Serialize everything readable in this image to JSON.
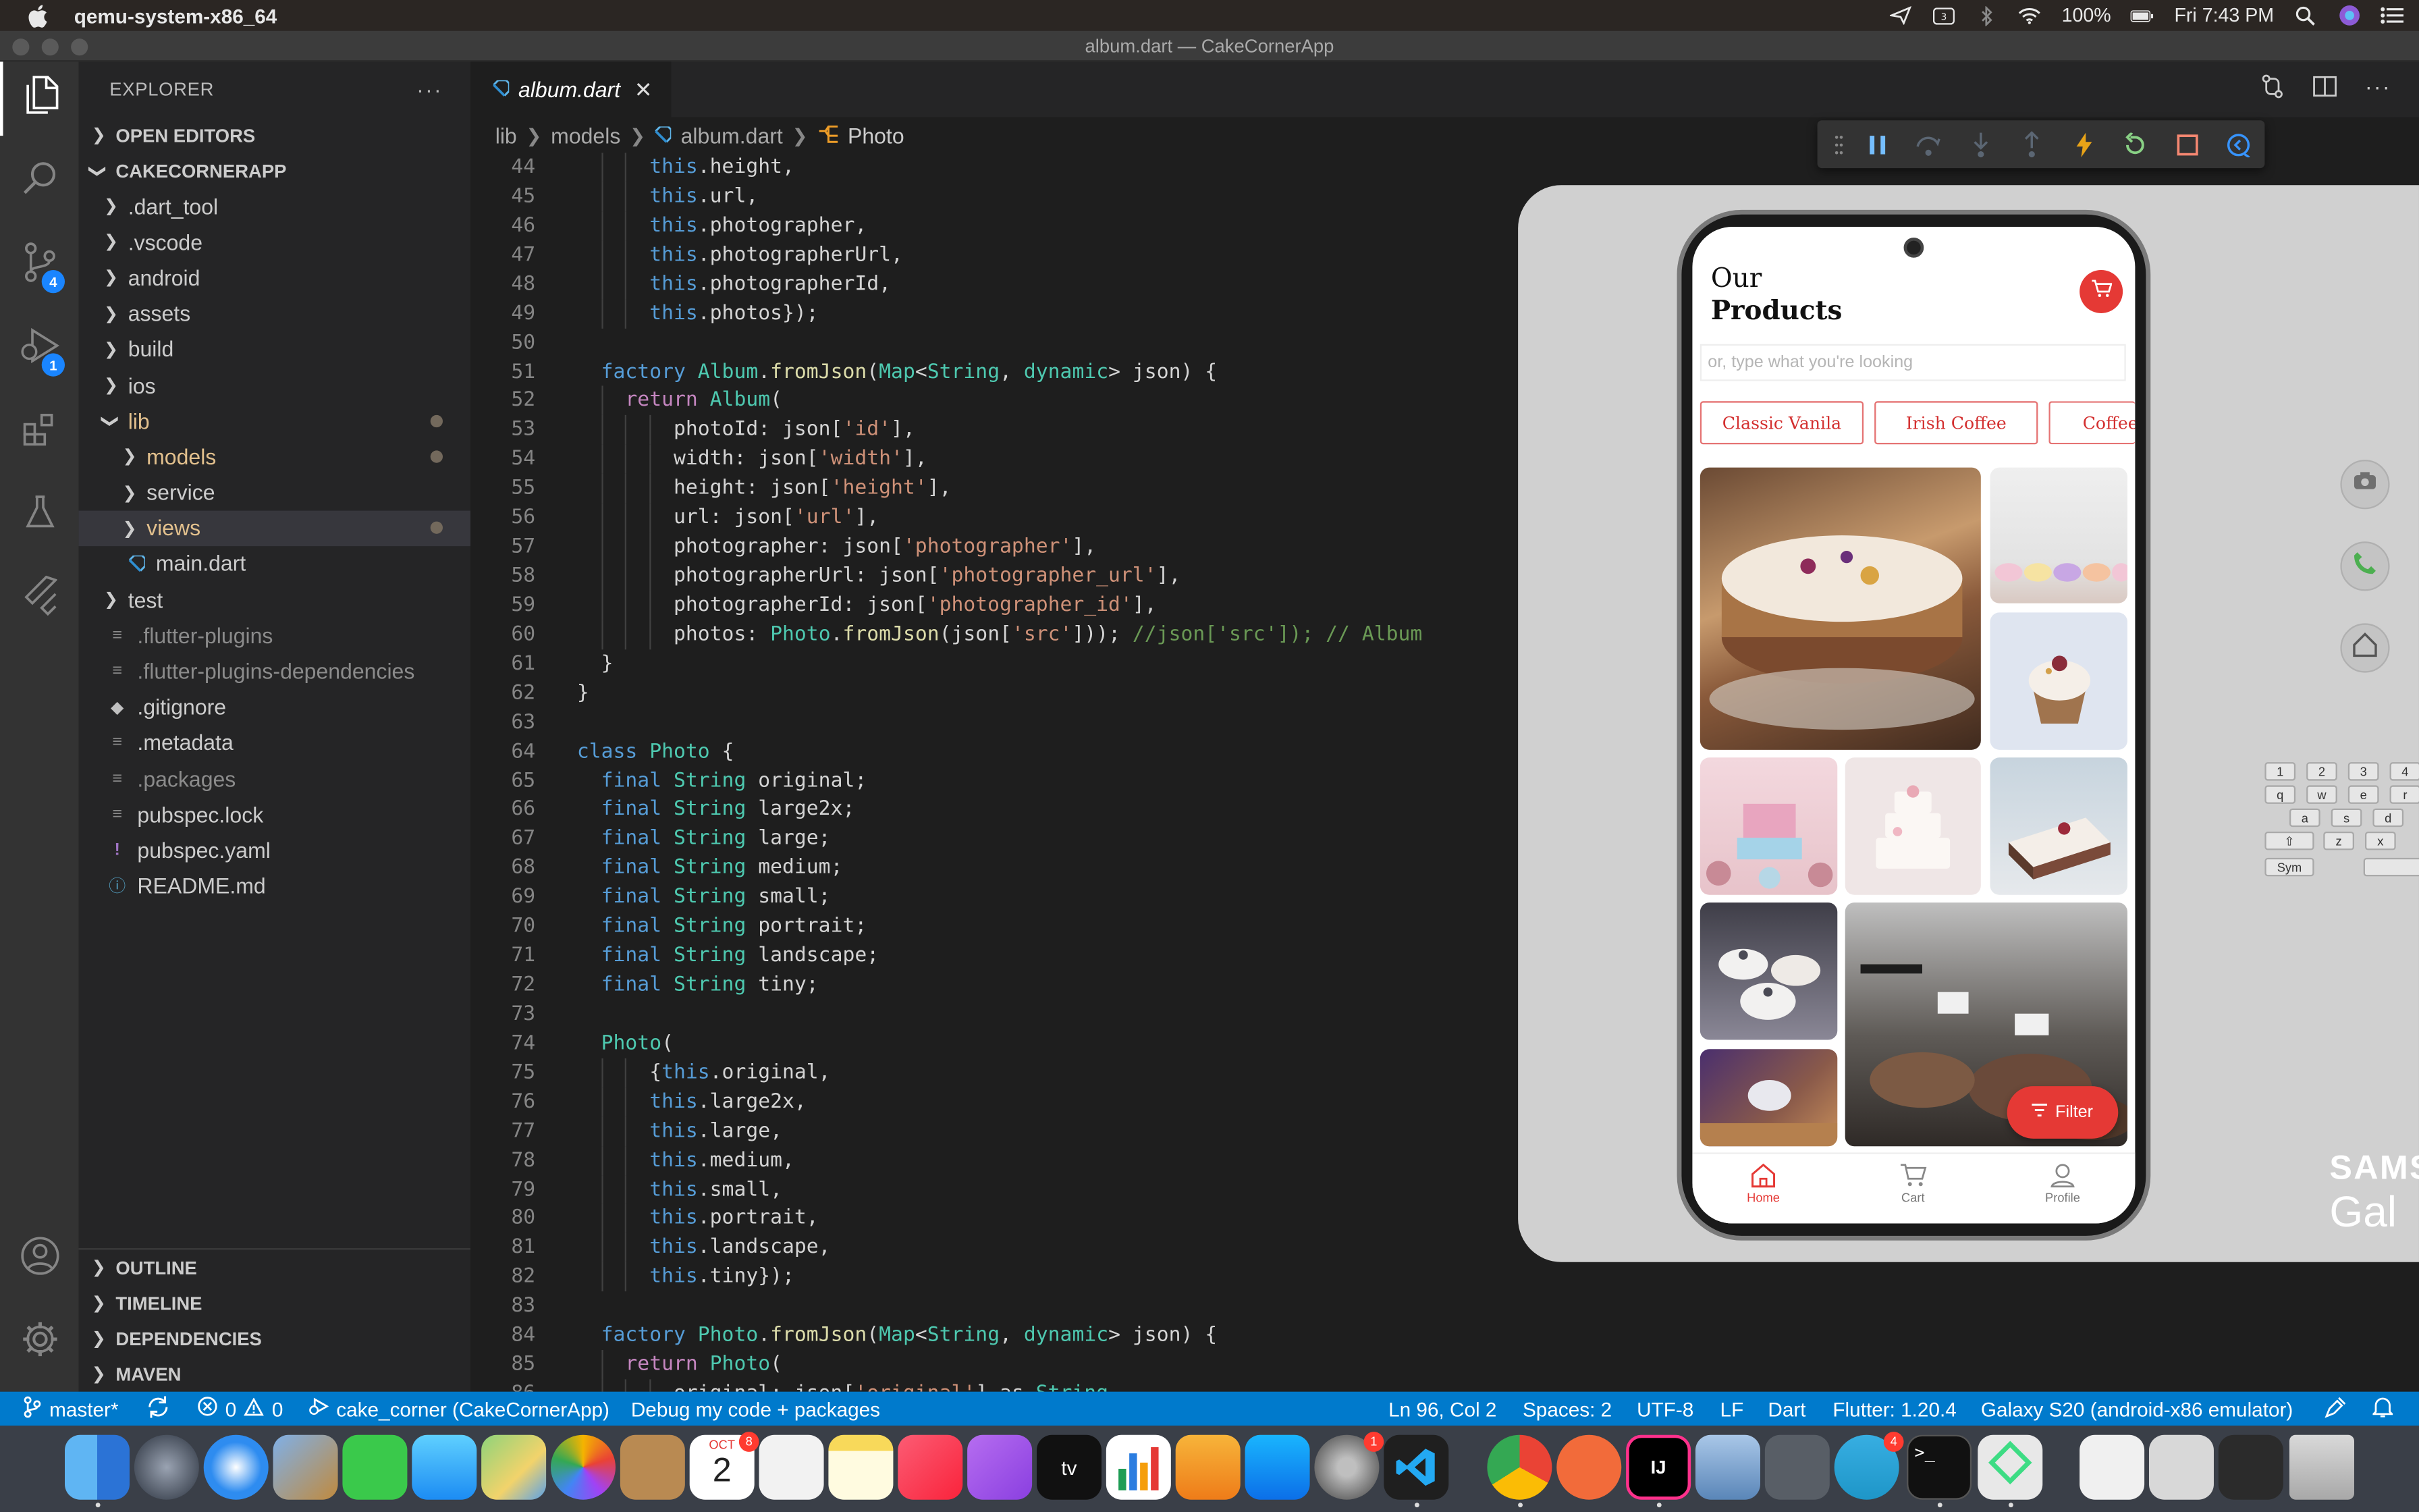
{
  "menubar": {
    "app_name": "qemu-system-x86_64",
    "battery": "100%",
    "clock": "Fri 7:43 PM"
  },
  "window": {
    "title": "album.dart — CakeCornerApp"
  },
  "activity_bar": {
    "scm_badge": "4",
    "debug_badge": "1"
  },
  "explorer": {
    "header": "EXPLORER",
    "more": "···",
    "open_editors": "OPEN EDITORS",
    "project": "CAKECORNERAPP",
    "tree": [
      {
        "label": ".dart_tool",
        "kind": "folder",
        "depth": 1
      },
      {
        "label": ".vscode",
        "kind": "folder",
        "depth": 1
      },
      {
        "label": "android",
        "kind": "folder",
        "depth": 1
      },
      {
        "label": "assets",
        "kind": "folder",
        "depth": 1
      },
      {
        "label": "build",
        "kind": "folder",
        "depth": 1
      },
      {
        "label": "ios",
        "kind": "folder",
        "depth": 1
      },
      {
        "label": "lib",
        "kind": "folder-open",
        "depth": 1,
        "modified": true
      },
      {
        "label": "models",
        "kind": "folder",
        "depth": 2,
        "modified": true
      },
      {
        "label": "service",
        "kind": "folder",
        "depth": 2
      },
      {
        "label": "views",
        "kind": "folder",
        "depth": 2,
        "modified": true,
        "selected": true
      },
      {
        "label": "main.dart",
        "kind": "dart",
        "depth": 2
      },
      {
        "label": "test",
        "kind": "folder",
        "depth": 1
      },
      {
        "label": ".flutter-plugins",
        "kind": "file",
        "depth": 1,
        "muted": true
      },
      {
        "label": ".flutter-plugins-dependencies",
        "kind": "file",
        "depth": 1,
        "muted": true
      },
      {
        "label": ".gitignore",
        "kind": "git",
        "depth": 1
      },
      {
        "label": ".metadata",
        "kind": "file",
        "depth": 1
      },
      {
        "label": ".packages",
        "kind": "file",
        "depth": 1,
        "muted": true
      },
      {
        "label": "pubspec.lock",
        "kind": "file",
        "depth": 1
      },
      {
        "label": "pubspec.yaml",
        "kind": "yaml",
        "depth": 1
      },
      {
        "label": "README.md",
        "kind": "info",
        "depth": 1
      }
    ],
    "bottom_sections": [
      "OUTLINE",
      "TIMELINE",
      "DEPENDENCIES",
      "MAVEN"
    ]
  },
  "editor": {
    "tab_label": "album.dart",
    "breadcrumb": [
      "lib",
      "models",
      "album.dart",
      "Photo"
    ],
    "lines": [
      {
        "n": "44",
        "i": 6,
        "t": [
          [
            "this",
            "k1"
          ],
          [
            ".height,",
            ""
          ]
        ]
      },
      {
        "n": "45",
        "i": 6,
        "t": [
          [
            "this",
            "k1"
          ],
          [
            ".url,",
            ""
          ]
        ]
      },
      {
        "n": "46",
        "i": 6,
        "t": [
          [
            "this",
            "k1"
          ],
          [
            ".photographer,",
            ""
          ]
        ]
      },
      {
        "n": "47",
        "i": 6,
        "t": [
          [
            "this",
            "k1"
          ],
          [
            ".photographerUrl,",
            ""
          ]
        ]
      },
      {
        "n": "48",
        "i": 6,
        "t": [
          [
            "this",
            "k1"
          ],
          [
            ".photographerId,",
            ""
          ]
        ]
      },
      {
        "n": "49",
        "i": 6,
        "t": [
          [
            "this",
            "k1"
          ],
          [
            ".photos});",
            ""
          ]
        ]
      },
      {
        "n": "50",
        "i": 0,
        "t": []
      },
      {
        "n": "51",
        "i": 2,
        "t": [
          [
            "factory ",
            "k1"
          ],
          [
            "Album",
            "ty"
          ],
          [
            ".",
            ""
          ],
          [
            "fromJson",
            "fn"
          ],
          [
            "(",
            ""
          ],
          [
            "Map",
            "ty"
          ],
          [
            "<",
            ""
          ],
          [
            "String",
            "ty"
          ],
          [
            ", ",
            ""
          ],
          [
            "dynamic",
            "ty"
          ],
          [
            "> json) {",
            ""
          ]
        ]
      },
      {
        "n": "52",
        "i": 4,
        "t": [
          [
            "return ",
            "k2"
          ],
          [
            "Album",
            "ty"
          ],
          [
            "(",
            ""
          ]
        ]
      },
      {
        "n": "53",
        "i": 8,
        "t": [
          [
            "photoId: json[",
            ""
          ],
          [
            "'id'",
            "st"
          ],
          [
            "],",
            ""
          ]
        ]
      },
      {
        "n": "54",
        "i": 8,
        "t": [
          [
            "width: json[",
            ""
          ],
          [
            "'width'",
            "st"
          ],
          [
            "],",
            ""
          ]
        ]
      },
      {
        "n": "55",
        "i": 8,
        "t": [
          [
            "height: json[",
            ""
          ],
          [
            "'height'",
            "st"
          ],
          [
            "],",
            ""
          ]
        ]
      },
      {
        "n": "56",
        "i": 8,
        "t": [
          [
            "url: json[",
            ""
          ],
          [
            "'url'",
            "st"
          ],
          [
            "],",
            ""
          ]
        ]
      },
      {
        "n": "57",
        "i": 8,
        "t": [
          [
            "photographer: json[",
            ""
          ],
          [
            "'photographer'",
            "st"
          ],
          [
            "],",
            ""
          ]
        ]
      },
      {
        "n": "58",
        "i": 8,
        "t": [
          [
            "photographerUrl: json[",
            ""
          ],
          [
            "'photographer_url'",
            "st"
          ],
          [
            "],",
            ""
          ]
        ]
      },
      {
        "n": "59",
        "i": 8,
        "t": [
          [
            "photographerId: json[",
            ""
          ],
          [
            "'photographer_id'",
            "st"
          ],
          [
            "],",
            ""
          ]
        ]
      },
      {
        "n": "60",
        "i": 8,
        "t": [
          [
            "photos: ",
            ""
          ],
          [
            "Photo",
            "ty"
          ],
          [
            ".",
            ""
          ],
          [
            "fromJson",
            "fn"
          ],
          [
            "(json[",
            ""
          ],
          [
            "'src'",
            "st"
          ],
          [
            "])); ",
            ""
          ],
          [
            "//json['src']); ",
            "cm"
          ],
          [
            "// Album",
            "cm"
          ]
        ]
      },
      {
        "n": "61",
        "i": 2,
        "t": [
          [
            "}",
            ""
          ]
        ]
      },
      {
        "n": "62",
        "i": 0,
        "t": [
          [
            "}",
            ""
          ]
        ]
      },
      {
        "n": "63",
        "i": 0,
        "t": []
      },
      {
        "n": "64",
        "i": 0,
        "t": [
          [
            "class ",
            "k1"
          ],
          [
            "Photo",
            "ty"
          ],
          [
            " {",
            ""
          ]
        ]
      },
      {
        "n": "65",
        "i": 2,
        "t": [
          [
            "final ",
            "k1"
          ],
          [
            "String",
            "ty"
          ],
          [
            " original;",
            ""
          ]
        ]
      },
      {
        "n": "66",
        "i": 2,
        "t": [
          [
            "final ",
            "k1"
          ],
          [
            "String",
            "ty"
          ],
          [
            " large2x;",
            ""
          ]
        ]
      },
      {
        "n": "67",
        "i": 2,
        "t": [
          [
            "final ",
            "k1"
          ],
          [
            "String",
            "ty"
          ],
          [
            " large;",
            ""
          ]
        ]
      },
      {
        "n": "68",
        "i": 2,
        "t": [
          [
            "final ",
            "k1"
          ],
          [
            "String",
            "ty"
          ],
          [
            " medium;",
            ""
          ]
        ]
      },
      {
        "n": "69",
        "i": 2,
        "t": [
          [
            "final ",
            "k1"
          ],
          [
            "String",
            "ty"
          ],
          [
            " small;",
            ""
          ]
        ]
      },
      {
        "n": "70",
        "i": 2,
        "t": [
          [
            "final ",
            "k1"
          ],
          [
            "String",
            "ty"
          ],
          [
            " portrait;",
            ""
          ]
        ]
      },
      {
        "n": "71",
        "i": 2,
        "t": [
          [
            "final ",
            "k1"
          ],
          [
            "String",
            "ty"
          ],
          [
            " landscape;",
            ""
          ]
        ]
      },
      {
        "n": "72",
        "i": 2,
        "t": [
          [
            "final ",
            "k1"
          ],
          [
            "String",
            "ty"
          ],
          [
            " tiny;",
            ""
          ]
        ]
      },
      {
        "n": "73",
        "i": 0,
        "t": []
      },
      {
        "n": "74",
        "i": 2,
        "t": [
          [
            "Photo",
            "ty"
          ],
          [
            "(",
            ""
          ]
        ]
      },
      {
        "n": "75",
        "i": 6,
        "t": [
          [
            "{",
            ""
          ],
          [
            "this",
            "k1"
          ],
          [
            ".original,",
            ""
          ]
        ]
      },
      {
        "n": "76",
        "i": 6,
        "t": [
          [
            "this",
            "k1"
          ],
          [
            ".large2x,",
            ""
          ]
        ]
      },
      {
        "n": "77",
        "i": 6,
        "t": [
          [
            "this",
            "k1"
          ],
          [
            ".large,",
            ""
          ]
        ]
      },
      {
        "n": "78",
        "i": 6,
        "t": [
          [
            "this",
            "k1"
          ],
          [
            ".medium,",
            ""
          ]
        ]
      },
      {
        "n": "79",
        "i": 6,
        "t": [
          [
            "this",
            "k1"
          ],
          [
            ".small,",
            ""
          ]
        ]
      },
      {
        "n": "80",
        "i": 6,
        "t": [
          [
            "this",
            "k1"
          ],
          [
            ".portrait,",
            ""
          ]
        ]
      },
      {
        "n": "81",
        "i": 6,
        "t": [
          [
            "this",
            "k1"
          ],
          [
            ".landscape,",
            ""
          ]
        ]
      },
      {
        "n": "82",
        "i": 6,
        "t": [
          [
            "this",
            "k1"
          ],
          [
            ".tiny});",
            ""
          ]
        ]
      },
      {
        "n": "83",
        "i": 0,
        "t": []
      },
      {
        "n": "84",
        "i": 2,
        "t": [
          [
            "factory ",
            "k1"
          ],
          [
            "Photo",
            "ty"
          ],
          [
            ".",
            ""
          ],
          [
            "fromJson",
            "fn"
          ],
          [
            "(",
            ""
          ],
          [
            "Map",
            "ty"
          ],
          [
            "<",
            ""
          ],
          [
            "String",
            "ty"
          ],
          [
            ", ",
            ""
          ],
          [
            "dynamic",
            "ty"
          ],
          [
            "> json) {",
            ""
          ]
        ]
      },
      {
        "n": "85",
        "i": 4,
        "t": [
          [
            "return ",
            "k2"
          ],
          [
            "Photo",
            "ty"
          ],
          [
            "(",
            ""
          ]
        ]
      },
      {
        "n": "86",
        "i": 8,
        "t": [
          [
            "original: json[",
            ""
          ],
          [
            "'original'",
            "st"
          ],
          [
            "] as ",
            ""
          ],
          [
            "String",
            "ty"
          ]
        ]
      }
    ]
  },
  "phone_app": {
    "title_line1": "Our",
    "title_line2": "Products",
    "search_placeholder": "or, type what you're looking",
    "chips": [
      "Classic Vanila",
      "Irish Coffee",
      "Coffee"
    ],
    "filter_label": "Filter",
    "nav": [
      "Home",
      "Cart",
      "Profile"
    ],
    "keyboard_rows": [
      [
        "1",
        "2",
        "3",
        "4"
      ],
      [
        "q",
        "w",
        "e",
        "r"
      ],
      [
        "a",
        "s",
        "d"
      ],
      [
        "z",
        "x"
      ]
    ],
    "keyboard_sym": "Sym",
    "brand_line1": "SAMS",
    "brand_line2": "Gal"
  },
  "status_bar": {
    "branch": "master*",
    "errors": "0",
    "warnings": "0",
    "config": "cake_corner (CakeCornerApp)",
    "debug_mode": "Debug my code + packages",
    "cursor": "Ln 96, Col 2",
    "spaces": "Spaces: 2",
    "encoding": "UTF-8",
    "eol": "LF",
    "language": "Dart",
    "flutter": "Flutter: 1.20.4",
    "device": "Galaxy S20 (android-x86 emulator)"
  },
  "dock": {
    "calendar_month": "OCT",
    "calendar_day": "2",
    "badges": {
      "calendar": "8",
      "settings": "1",
      "telegram": "4"
    }
  }
}
